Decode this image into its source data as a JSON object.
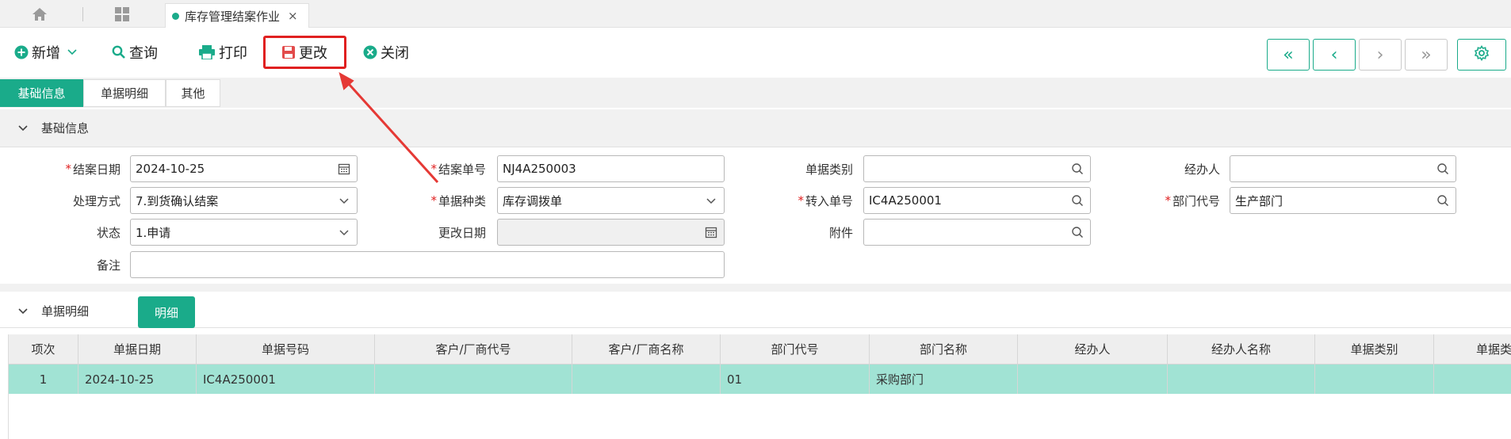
{
  "top_tabs": {
    "home_icon": "home-icon",
    "apps_icon": "grid-icon",
    "active_tab_label": "库存管理结案作业",
    "close_glyph": "×"
  },
  "toolbar": {
    "new_label": "新增",
    "query_label": "查询",
    "print_label": "打印",
    "edit_label": "更改",
    "close_label": "关闭",
    "nav": [
      "«",
      "‹",
      "›",
      "»"
    ],
    "accent": "#1aab8a",
    "highlight_color": "#e02020"
  },
  "tabs": [
    "基础信息",
    "单据明细",
    "其他"
  ],
  "sections": {
    "basic": "基础信息",
    "detail": "单据明细",
    "detail_button": "明细"
  },
  "form": {
    "close_date_label": "结案日期",
    "close_date_value": "2024-10-25",
    "close_no_label": "结案单号",
    "close_no_value": "NJ4A250003",
    "doc_type_label": "单据类别",
    "doc_type_value": "",
    "handler_label": "经办人",
    "handler_value": "",
    "method_label": "处理方式",
    "method_value": "7.到货确认结案",
    "doc_kind_label": "单据种类",
    "doc_kind_value": "库存调拨单",
    "transfer_no_label": "转入单号",
    "transfer_no_value": "IC4A250001",
    "dept_code_label": "部门代号",
    "dept_code_value": "生产部门",
    "status_label": "状态",
    "status_value": "1.申请",
    "change_date_label": "更改日期",
    "change_date_value": "",
    "attachment_label": "附件",
    "attachment_value": "",
    "remark_label": "备注",
    "remark_value": "",
    "required_mark": "*"
  },
  "table": {
    "columns": [
      "项次",
      "单据日期",
      "单据号码",
      "客户/厂商代号",
      "客户/厂商名称",
      "部门代号",
      "部门名称",
      "经办人",
      "经办人名称",
      "单据类别",
      "单据类"
    ],
    "rows": [
      [
        "1",
        "2024-10-25",
        "IC4A250001",
        "",
        "",
        "01",
        "采购部门",
        "",
        "",
        "",
        ""
      ]
    ]
  }
}
